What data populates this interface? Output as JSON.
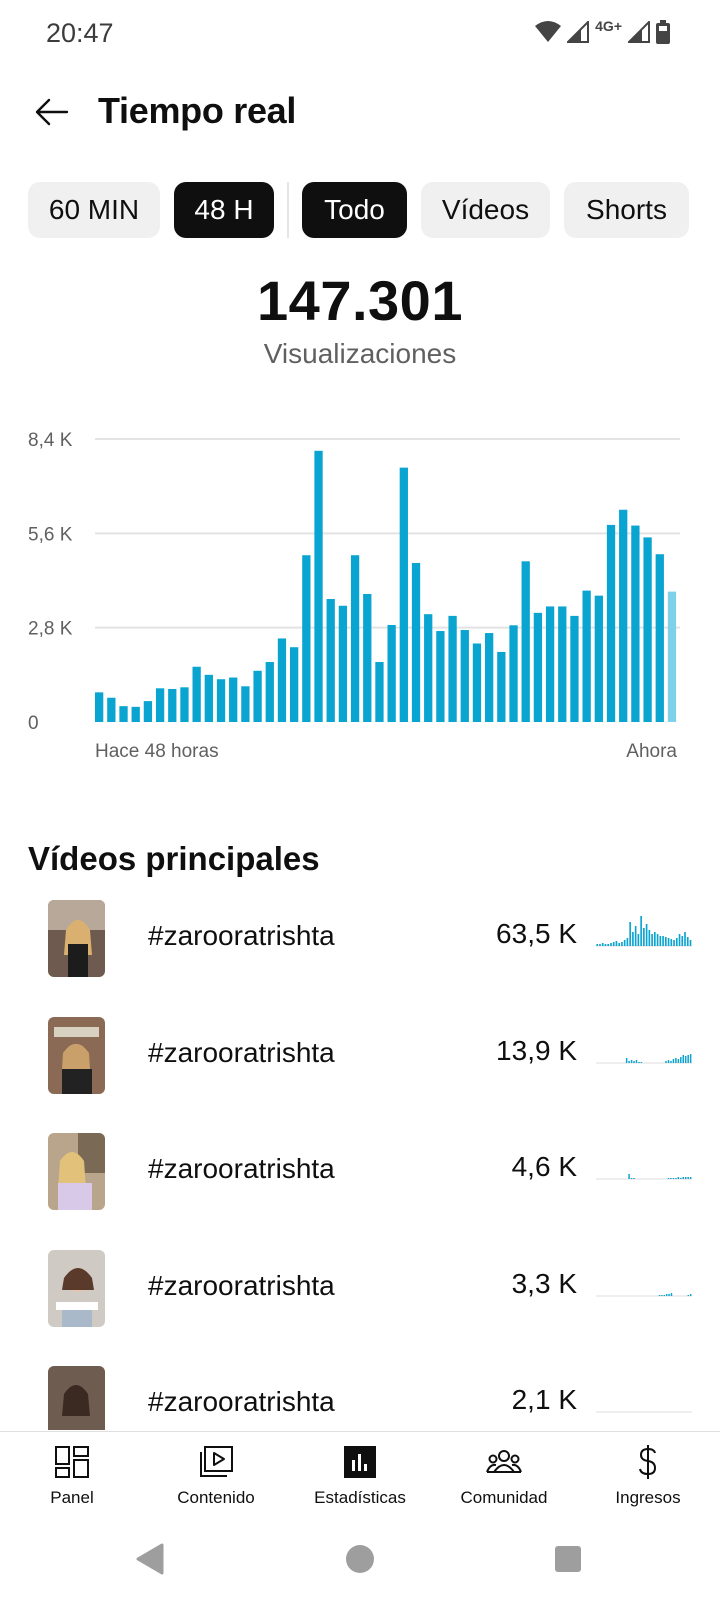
{
  "status_bar": {
    "time": "20:47",
    "network": "4G+"
  },
  "header": {
    "title": "Tiempo real",
    "back_icon": "arrow-left-icon"
  },
  "chips": [
    {
      "label": "60 MIN",
      "selected": false
    },
    {
      "label": "48 H",
      "selected": true
    },
    {
      "label": "Todo",
      "selected": true
    },
    {
      "label": "Vídeos",
      "selected": false
    },
    {
      "label": "Shorts",
      "selected": false
    }
  ],
  "metric": {
    "value": "147.301",
    "label": "Visualizaciones"
  },
  "chart_data": {
    "type": "bar",
    "title": "",
    "xlabel": "",
    "ylabel": "",
    "x_start_label": "Hace 48 horas",
    "x_end_label": "Ahora",
    "ytick_labels": [
      "0",
      "2,8 K",
      "5,6 K",
      "8,4 K"
    ],
    "ytick_values": [
      0,
      2800,
      5600,
      8400
    ],
    "ylim": [
      0,
      8400
    ],
    "grid": true,
    "bar_color": "#0aa4d1",
    "current_bar_color": "#7fd1ea",
    "values": [
      880,
      720,
      470,
      450,
      620,
      1000,
      980,
      1030,
      1640,
      1400,
      1270,
      1320,
      1060,
      1520,
      1780,
      2480,
      2220,
      4950,
      8050,
      3650,
      3450,
      4950,
      3800,
      1780,
      2880,
      7550,
      4720,
      3200,
      2700,
      3150,
      2730,
      2330,
      2640,
      2080,
      2870,
      4770,
      3240,
      3430,
      3430,
      3150,
      3900,
      3750,
      5850,
      6300,
      5830,
      5480,
      4980,
      3870
    ]
  },
  "top_videos": {
    "title": "Vídeos principales",
    "items": [
      {
        "title": "#zarooratrishta",
        "views": "63,5 K",
        "spark": [
          2,
          2,
          3,
          2,
          2,
          3,
          4,
          5,
          3,
          4,
          6,
          8,
          24,
          14,
          20,
          12,
          30,
          18,
          22,
          16,
          12,
          14,
          12,
          10,
          10,
          9,
          8,
          7,
          6,
          8,
          12,
          10,
          14,
          9,
          6
        ]
      },
      {
        "title": "#zarooratrishta",
        "views": "13,9 K",
        "spark": [
          0,
          0,
          0,
          0,
          0,
          0,
          0,
          0,
          0,
          0,
          0,
          0,
          5,
          2,
          3,
          2,
          3,
          1,
          1,
          0,
          0,
          0,
          0,
          0,
          0,
          0,
          0,
          0,
          2,
          3,
          2,
          4,
          5,
          4,
          6,
          8,
          7,
          8,
          9
        ]
      },
      {
        "title": "#zarooratrishta",
        "views": "4,6 K",
        "spark": [
          0,
          0,
          0,
          0,
          0,
          0,
          0,
          0,
          0,
          0,
          0,
          0,
          0,
          5,
          1,
          1,
          0,
          0,
          0,
          0,
          0,
          0,
          0,
          0,
          0,
          0,
          0,
          0,
          0,
          1,
          1,
          1,
          1,
          2,
          1,
          2,
          2,
          2,
          2
        ]
      },
      {
        "title": "#zarooratrishta",
        "views": "3,3 K",
        "spark": [
          0,
          0,
          0,
          0,
          0,
          0,
          0,
          0,
          0,
          0,
          0,
          0,
          0,
          0,
          0,
          0,
          0,
          0,
          0,
          0,
          0,
          0,
          0,
          0,
          0,
          0,
          1,
          1,
          1,
          2,
          2,
          3,
          0,
          0,
          0,
          0,
          0,
          0,
          1,
          2
        ]
      },
      {
        "title": "#zarooratrishta",
        "views": "2,1 K",
        "spark": [
          0,
          0,
          0,
          0,
          0,
          0,
          0,
          0,
          0,
          0,
          0,
          0,
          0,
          0,
          0,
          0,
          0,
          0,
          0,
          0
        ]
      }
    ]
  },
  "bottom_nav": [
    {
      "label": "Panel",
      "icon": "dashboard-icon"
    },
    {
      "label": "Contenido",
      "icon": "content-icon"
    },
    {
      "label": "Estadísticas",
      "icon": "analytics-icon",
      "active": true
    },
    {
      "label": "Comunidad",
      "icon": "community-icon"
    },
    {
      "label": "Ingresos",
      "icon": "dollar-icon"
    }
  ],
  "colors": {
    "accent": "#0aa4d1",
    "chip_selected": "#0f0f0f",
    "chip_default": "#f0f0f0"
  }
}
